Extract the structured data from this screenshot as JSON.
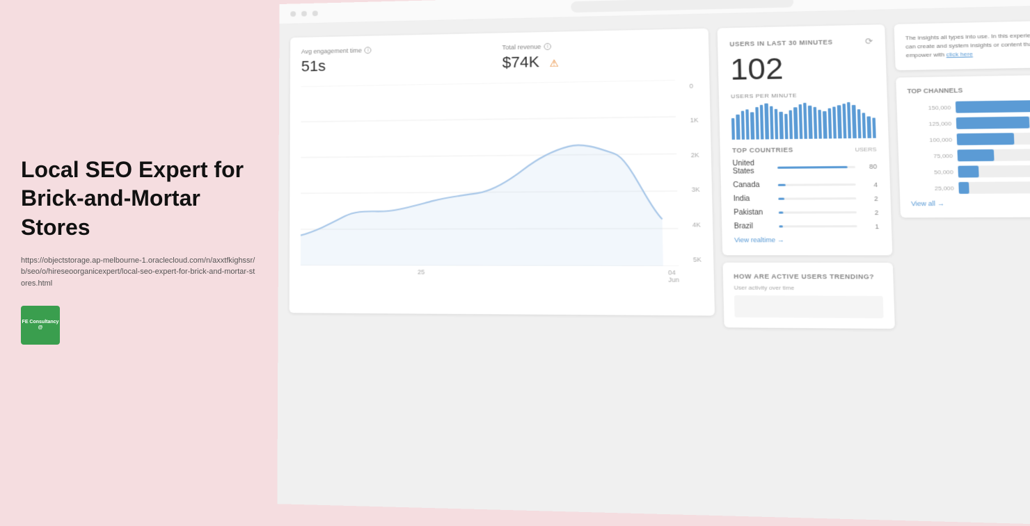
{
  "left": {
    "title": "Local SEO Expert for Brick-and-Mortar Stores",
    "url": "https://objectstorage.ap-melbourne-1.oraclecloud.com/n/axxtfkighssr/b/seo/o/hireseoorganicexpert/local-seo-expert-for-brick-and-mortar-stores.html",
    "logo_line1": "FE Consultancy",
    "logo_line2": "@"
  },
  "analytics": {
    "engagement_label": "Avg engagement time",
    "engagement_value": "51s",
    "revenue_label": "Total revenue",
    "revenue_value": "$74K",
    "users_last_30_label": "USERS IN LAST 30 MINUTES",
    "users_count": "102",
    "users_per_min_label": "USERS PER MINUTE",
    "top_countries_label": "TOP COUNTRIES",
    "users_col_label": "USERS",
    "countries": [
      {
        "name": "United States",
        "bar": 90,
        "count": "80"
      },
      {
        "name": "Canada",
        "bar": 10,
        "count": "4"
      },
      {
        "name": "India",
        "bar": 8,
        "count": "2"
      },
      {
        "name": "Pakistan",
        "bar": 6,
        "count": "2"
      },
      {
        "name": "Brazil",
        "bar": 5,
        "count": "1"
      }
    ],
    "view_realtime": "View realtime →",
    "how_trending_label": "HOW ARE ACTIVE USERS TRENDING?",
    "user_activity_label": "User activity over time",
    "x_axis": [
      "",
      "25",
      "",
      "04 Jun"
    ],
    "y_axis": [
      "0",
      "1K",
      "2K",
      "3K",
      "4K",
      "5K"
    ],
    "bar_heights": [
      30,
      35,
      40,
      42,
      38,
      45,
      48,
      50,
      46,
      42,
      38,
      35,
      40,
      44,
      48,
      50,
      46,
      44,
      40,
      38,
      42,
      44,
      46,
      48,
      50,
      46,
      40,
      35,
      30,
      28
    ],
    "right_chart_title": "Top Channels",
    "h_bars": [
      {
        "label": "150,000",
        "width": 95
      },
      {
        "label": "125,000",
        "width": 70
      },
      {
        "label": "100,000",
        "width": 55
      },
      {
        "label": "75,000",
        "width": 35
      },
      {
        "label": "50,000",
        "width": 20
      },
      {
        "label": "25,000",
        "width": 10
      }
    ],
    "desc_text": "The insights all types into use. In this experience, you can create and system insights or content that help empower with",
    "desc_link": "click here"
  }
}
